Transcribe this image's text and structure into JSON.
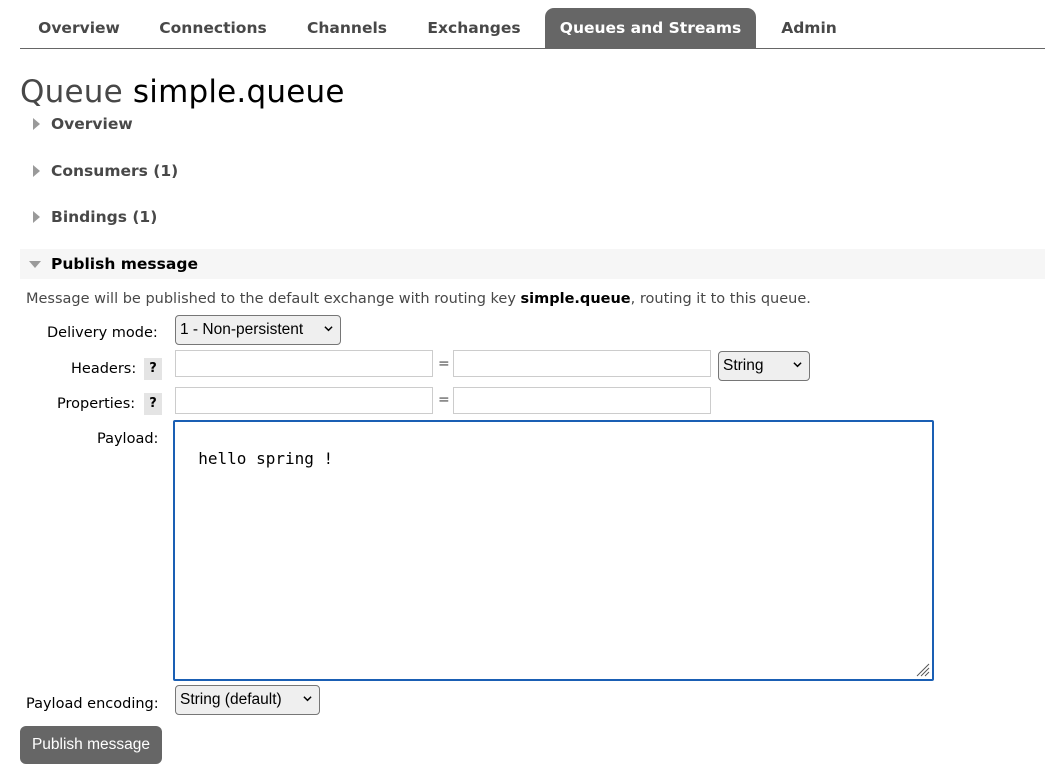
{
  "tabs": [
    {
      "label": "Overview"
    },
    {
      "label": "Connections"
    },
    {
      "label": "Channels"
    },
    {
      "label": "Exchanges"
    },
    {
      "label": "Queues and Streams",
      "active": true
    },
    {
      "label": "Admin"
    }
  ],
  "page": {
    "kind": "Queue",
    "name": "simple.queue"
  },
  "sections": {
    "overview": "Overview",
    "consumers": "Consumers (1)",
    "bindings": "Bindings (1)",
    "publish": "Publish message"
  },
  "publish": {
    "desc_prefix": "Message will be published to the default exchange with routing key ",
    "desc_key": "simple.queue",
    "desc_suffix": ", routing it to this queue.",
    "delivery_mode_label": "Delivery mode:",
    "delivery_mode_value": "1 - Non-persistent",
    "headers_label": "Headers:",
    "headers_type_value": "String",
    "properties_label": "Properties:",
    "help_glyph": "?",
    "equals": "=",
    "payload_label": "Payload:",
    "payload_value": "hello spring !",
    "payload_encoding_label": "Payload encoding:",
    "payload_encoding_value": "String (default)",
    "publish_button": "Publish message"
  },
  "colors": {
    "tab_active_bg": "#666666",
    "button_bg": "#666666",
    "focus_border": "#1a5fb4"
  }
}
